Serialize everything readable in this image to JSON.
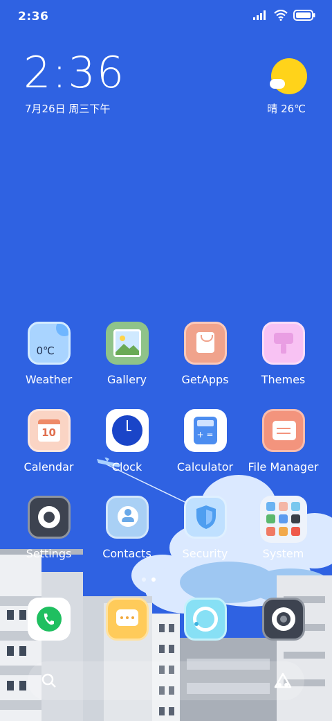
{
  "status_bar": {
    "time": "2:36"
  },
  "widget": {
    "time": "2:36",
    "date": "7月26日 周三下午",
    "weather": "晴 26℃"
  },
  "apps": [
    {
      "label": "Weather",
      "tile_text": "0℃"
    },
    {
      "label": "Gallery"
    },
    {
      "label": "GetApps"
    },
    {
      "label": "Themes"
    },
    {
      "label": "Calendar",
      "tile_text": "10"
    },
    {
      "label": "Clock"
    },
    {
      "label": "Calculator"
    },
    {
      "label": "File Manager"
    },
    {
      "label": "Settings"
    },
    {
      "label": "Contacts"
    },
    {
      "label": "Security"
    },
    {
      "label": "System"
    }
  ],
  "dock": [
    {
      "name": "phone-icon"
    },
    {
      "name": "messages-icon"
    },
    {
      "name": "browser-icon"
    },
    {
      "name": "camera-icon"
    }
  ],
  "colors": {
    "sky": "#2f62e2",
    "sun": "#ffd31a"
  }
}
